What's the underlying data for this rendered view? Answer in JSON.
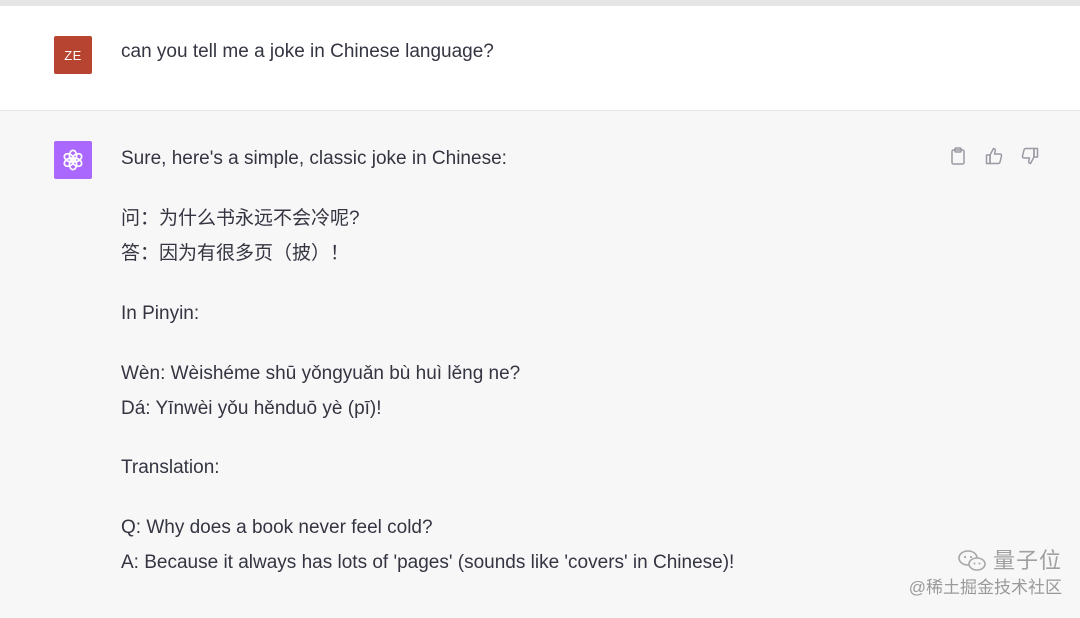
{
  "user_message": {
    "avatar_initials": "ZE",
    "avatar_color": "#b64431",
    "text": "can you tell me a joke in Chinese language?"
  },
  "assistant_message": {
    "avatar_icon": "openai-logo-icon",
    "avatar_color": "#ab68ff",
    "lines": [
      "Sure, here's a simple, classic joke in Chinese:",
      "问：为什么书永远不会冷呢?",
      "答：因为有很多页（披）！",
      "In Pinyin:",
      "Wèn: Wèishéme shū yǒngyuǎn bù huì lěng ne?",
      "Dá: Yīnwèi yǒu hěnduō yè (pī)!",
      "Translation:",
      "Q: Why does a book never feel cold?",
      "A: Because it always has lots of 'pages' (sounds like 'covers' in Chinese)!"
    ],
    "actions": [
      "clipboard-icon",
      "thumbs-up-icon",
      "thumbs-down-icon"
    ]
  },
  "watermark": {
    "brand": "量子位",
    "sub": "@稀土掘金技术社区"
  }
}
